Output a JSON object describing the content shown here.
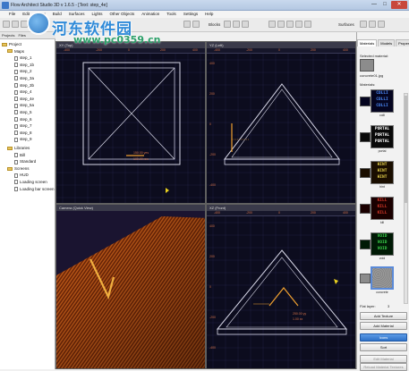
{
  "window": {
    "title": "Flow Architect Studio 3D v 1.6.5 - [Text: step_4e]",
    "minimize": "—",
    "maximize": "□",
    "close": "✕"
  },
  "menu": [
    "File",
    "Edit",
    "View",
    "Build",
    "Surfaces",
    "Lights",
    "Other Objects",
    "Animation",
    "Tools",
    "Settings",
    "Help"
  ],
  "toolbar": {
    "blocks_label": "Blocks",
    "surfaces_label": "Surfaces"
  },
  "watermark": {
    "cn": "河东软件园",
    "url": "www.pc0359.cn"
  },
  "tree": {
    "tabs": [
      "Projects",
      "Files"
    ],
    "root": "Project",
    "maps_label": "Maps",
    "maps": [
      "step_1",
      "step_1b",
      "step_2",
      "step_3a",
      "step_3b",
      "step_4",
      "step_4e",
      "step_5a",
      "step_5",
      "step_6",
      "step_7",
      "step_8",
      "step_9"
    ],
    "libraries_label": "Libraries",
    "libraries": [
      "Bill",
      "Standard"
    ],
    "screens_label": "Screens",
    "screens": [
      "HUD",
      "Loading screen",
      "Loading bar screen"
    ]
  },
  "viewports": {
    "top": {
      "title": "XY (Top)",
      "ruler": [
        "-400",
        "-200",
        "0",
        "200",
        "400"
      ],
      "coord_labels": [
        "150.00 yes",
        "100.00 xxx"
      ]
    },
    "left": {
      "title": "YZ (Left)",
      "ruler": [
        "-400",
        "-200",
        "0",
        "200",
        "400"
      ],
      "side": [
        "400",
        "200",
        "0",
        "-200",
        "-400"
      ]
    },
    "camera": {
      "title": "Camera (Quick View)"
    },
    "front": {
      "title": "XZ (Front)",
      "ruler": [
        "-400",
        "-200",
        "0",
        "200",
        "400"
      ],
      "side": [
        "400",
        "200",
        "0",
        "-200",
        "-400"
      ],
      "coord_labels": [
        "250.00 yy",
        "1.00 xx"
      ]
    }
  },
  "right_panel": {
    "tabs": [
      "Materials",
      "Models",
      "Properties"
    ],
    "selected_material_label": "Selected material:",
    "selected_material_name": "concrete01.jpg",
    "materials_label": "Materials:",
    "materials": [
      {
        "name": "colli",
        "words": [
          "COLLI",
          "COLLI",
          "COLLI"
        ],
        "fg": "#4d8dff",
        "bg": "#050520"
      },
      {
        "name": "portal",
        "words": [
          "PORTAL",
          "PORTAL",
          "PORTAL"
        ],
        "fg": "#ffffff",
        "bg": "#0a0a0a"
      },
      {
        "name": "hint",
        "words": [
          "HINT",
          "HINT",
          "HINT"
        ],
        "fg": "#e6d24a",
        "bg": "#1a0e00"
      },
      {
        "name": "kill",
        "words": [
          "KILL",
          "KILL",
          "KILL"
        ],
        "fg": "#e03a2a",
        "bg": "#1a0000"
      },
      {
        "name": "void",
        "words": [
          "VOID",
          "VOID",
          "VOID"
        ],
        "fg": "#3ad24a",
        "bg": "#001a05"
      },
      {
        "name": "concrete",
        "words": [],
        "fg": "#9a9a9a",
        "bg": "#8c8c8c"
      }
    ],
    "flat_layer_label": "Flat layer:",
    "flat_layer_value": "3",
    "buttons": [
      {
        "label": "Add Texture",
        "style": "normal"
      },
      {
        "label": "Add Material",
        "style": "normal"
      },
      {
        "label": "Icons",
        "style": "primary"
      },
      {
        "label": "Sort",
        "style": "normal"
      },
      {
        "label": "Edit Material",
        "style": "disabled"
      },
      {
        "label": "Reload Material Textures",
        "style": "disabled"
      }
    ]
  },
  "colors": {
    "viewport_bg": "#0c0c1e",
    "grid": "#24244a",
    "geometry": "#d8d8e8",
    "selected": "#f0a030",
    "pyramid": "#c85a14"
  }
}
